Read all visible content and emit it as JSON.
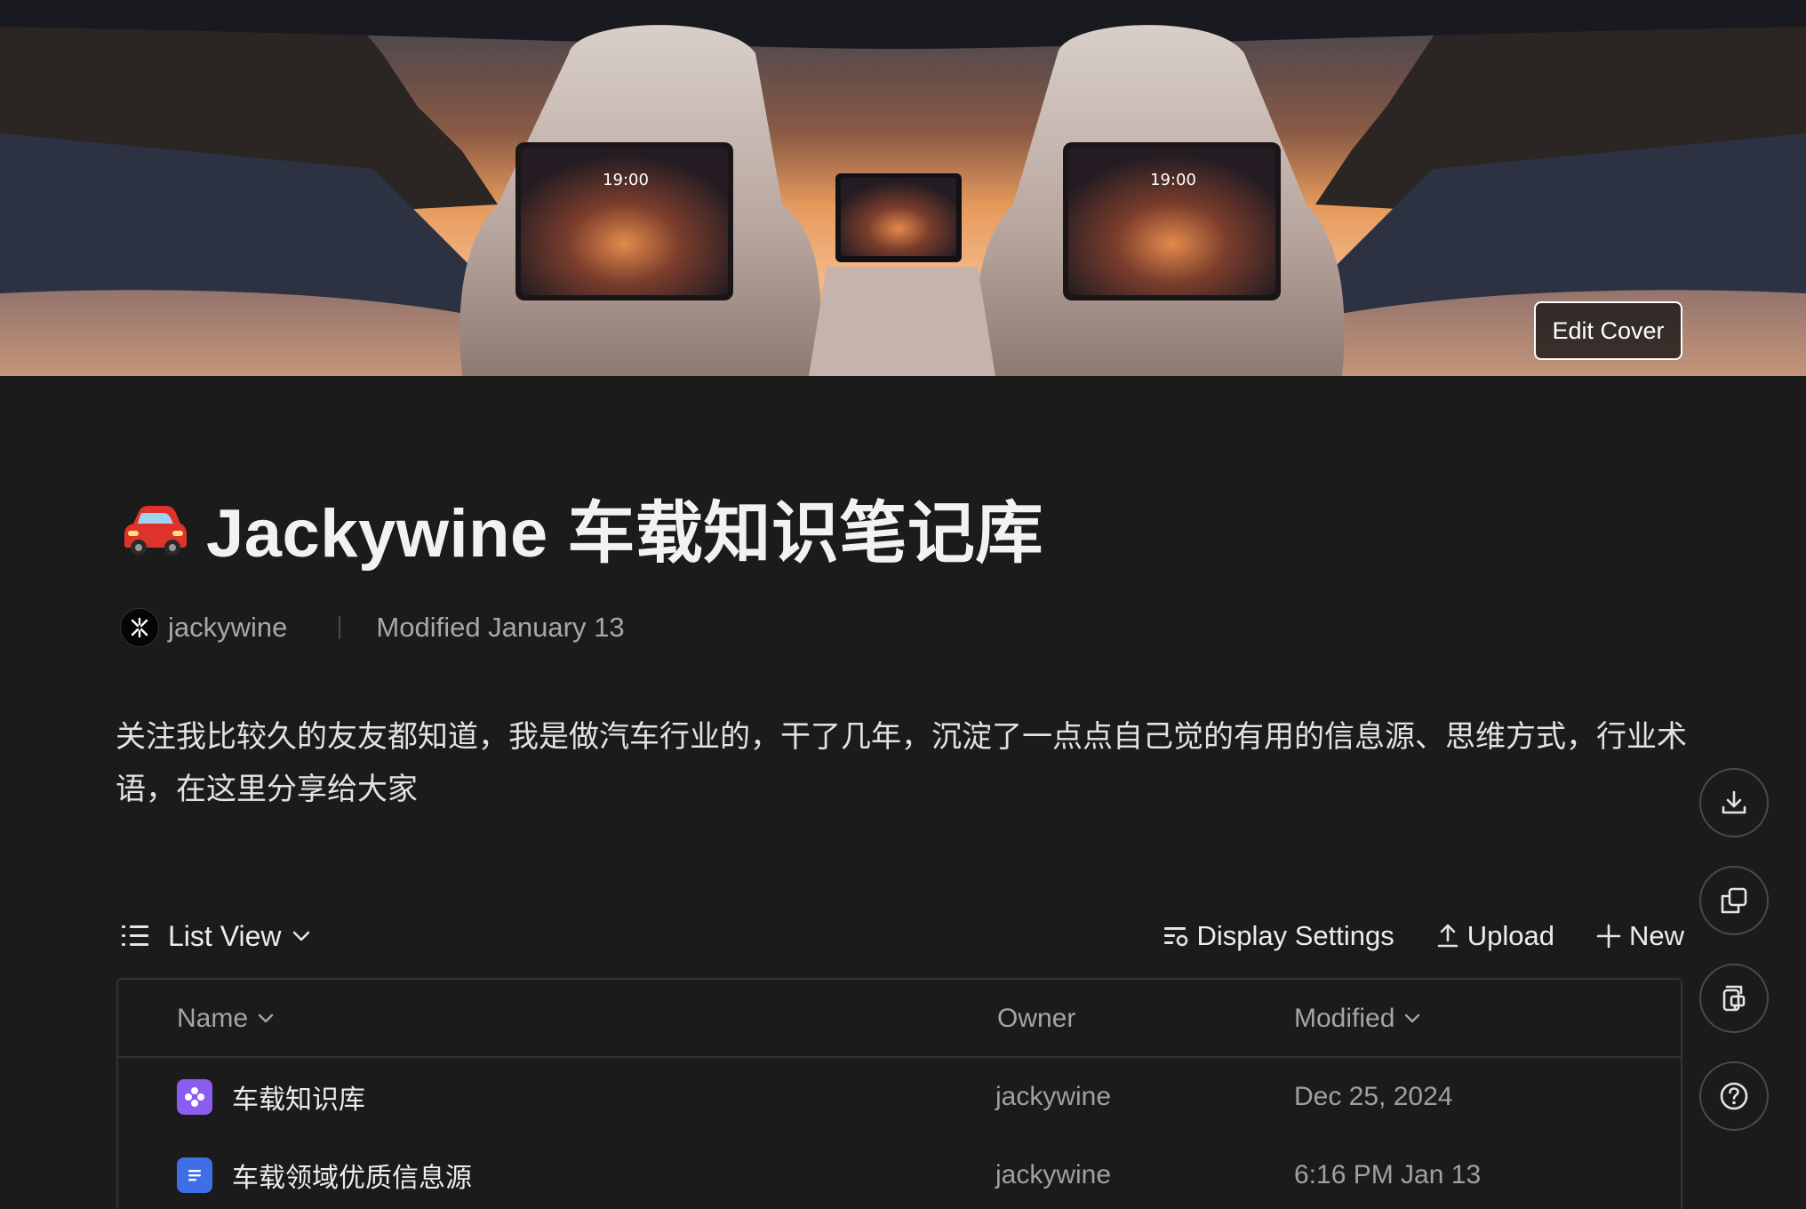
{
  "cover": {
    "edit_label": "Edit Cover",
    "screen_clock_left": "19:00",
    "screen_clock_right": "19:00"
  },
  "page": {
    "emoji_icon": "red-car-icon",
    "title": "Jackywine 车载知识笔记库",
    "owner": "jackywine",
    "modified": "Modified January 13",
    "description": "关注我比较久的友友都知道，我是做汽车行业的，干了几年，沉淀了一点点自己觉的有用的信息源、思维方式，行业术语，在这里分享给大家"
  },
  "toolbar": {
    "view_label": "List View",
    "display_settings_label": "Display Settings",
    "upload_label": "Upload",
    "new_label": "New"
  },
  "table": {
    "columns": {
      "name": "Name",
      "owner": "Owner",
      "modified": "Modified"
    },
    "rows": [
      {
        "icon": "knowledge-base-icon",
        "name": "车载知识库",
        "owner": "jackywine",
        "modified": "Dec 25, 2024"
      },
      {
        "icon": "document-icon",
        "name": "车载领域优质信息源",
        "owner": "jackywine",
        "modified": "6:16 PM Jan 13"
      }
    ]
  },
  "floating": [
    "download-icon",
    "copy-icon",
    "template-icon",
    "help-icon"
  ],
  "colors": {
    "background": "#1b1b1b",
    "kb_icon": "#8a5cf0",
    "doc_icon": "#3f6fe6"
  }
}
